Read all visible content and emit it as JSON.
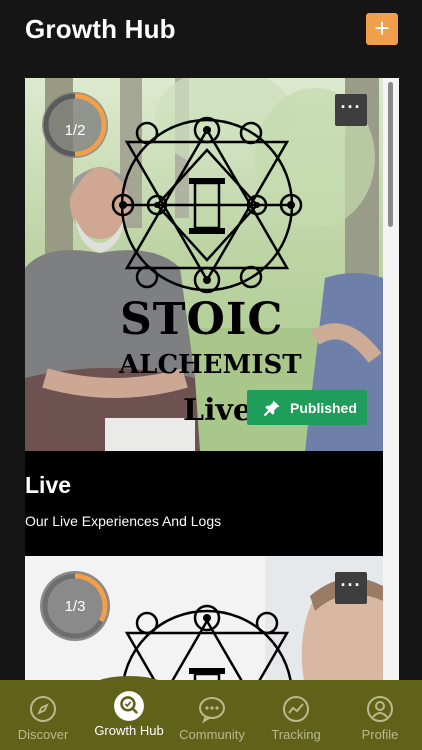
{
  "header": {
    "title": "Growth Hub",
    "add_icon": "plus-icon",
    "add_label": "+"
  },
  "colors": {
    "background": "#151515",
    "accent": "#f0a04b",
    "published": "#1f9d5b",
    "tabbar": "#5f6218"
  },
  "cards": [
    {
      "progress_label": "1/2",
      "progress_value": 0.5,
      "more_label": "···",
      "logo_line1": "STOIC",
      "logo_line2": "ALCHEMIST",
      "logo_script": "Live",
      "status_label": "Published",
      "status_icon": "pin-icon",
      "title": "Live",
      "subtitle": "Our Live Experiences And Logs"
    },
    {
      "progress_label": "1/3",
      "progress_value": 0.333,
      "more_label": "···"
    }
  ],
  "tabs": [
    {
      "label": "Discover",
      "icon": "compass-icon",
      "active": false
    },
    {
      "label": "Growth Hub",
      "icon": "growth-search-icon",
      "active": true
    },
    {
      "label": "Community",
      "icon": "chat-bubble-icon",
      "active": false
    },
    {
      "label": "Tracking",
      "icon": "tracking-chart-icon",
      "active": false
    },
    {
      "label": "Profile",
      "icon": "person-icon",
      "active": false
    }
  ]
}
